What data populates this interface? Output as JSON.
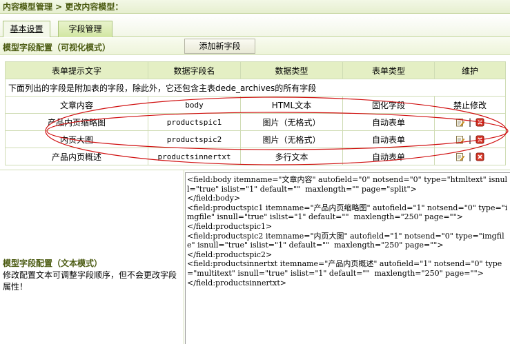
{
  "breadcrumb": "内容模型管理 > 更改内容模型：",
  "tabs": [
    {
      "label": "基本设置",
      "active": false
    },
    {
      "label": "字段管理",
      "active": true
    }
  ],
  "visual_config": {
    "title": "模型字段配置（可视化模式）",
    "add_button": "添加新字段"
  },
  "table": {
    "headers": [
      "表单提示文字",
      "数据字段名",
      "数据类型",
      "表单类型",
      "维护"
    ],
    "note": "下面列出的字段是附加表的字段，除此外，它还包含主表dede_archives的所有字段",
    "rows": [
      {
        "label": "文章内容",
        "field": "body",
        "dtype": "HTML文本",
        "ftype": "固化字段",
        "maint": "禁止修改"
      },
      {
        "label": "产品内页缩略图",
        "field": "productspic1",
        "dtype": "图片（无格式）",
        "ftype": "自动表单",
        "maint": ""
      },
      {
        "label": "内页大图",
        "field": "productspic2",
        "dtype": "图片（无格式）",
        "ftype": "自动表单",
        "maint": ""
      },
      {
        "label": "产品内页概述",
        "field": "productsinnertxt",
        "dtype": "多行文本",
        "ftype": "自动表单",
        "maint": ""
      }
    ],
    "icons": [
      "edit-icon",
      "delete-icon"
    ],
    "separator": "|"
  },
  "text_config": {
    "title": "模型字段配置（文本模式）",
    "description": "修改配置文本可调整字段顺序，但不会更改字段属性！",
    "content": "<field:body itemname=\"文章内容\" autofield=\"0\" notsend=\"0\" type=\"htmltext\" isnull=\"true\" islist=\"1\" default=\"\"  maxlength=\"\" page=\"split\">\n</field:body>\n<field:productspic1 itemname=\"产品内页缩略图\" autofield=\"1\" notsend=\"0\" type=\"imgfile\" isnull=\"true\" islist=\"1\" default=\"\"  maxlength=\"250\" page=\"\">\n</field:productspic1>\n<field:productspic2 itemname=\"内页大图\" autofield=\"1\" notsend=\"0\" type=\"imgfile\" isnull=\"true\" islist=\"1\" default=\"\"  maxlength=\"250\" page=\"\">\n</field:productspic2>\n<field:productsinnertxt itemname=\"产品内页概述\" autofield=\"1\" notsend=\"0\" type=\"multitext\" isnull=\"true\" islist=\"1\" default=\"\"  maxlength=\"250\" page=\"\">\n</field:productsinnertxt>"
  },
  "colors": {
    "header_bg": "#e4efc4",
    "border": "#cfdcb4",
    "title_text": "#4a5a10",
    "annotation_red": "#d01010"
  }
}
